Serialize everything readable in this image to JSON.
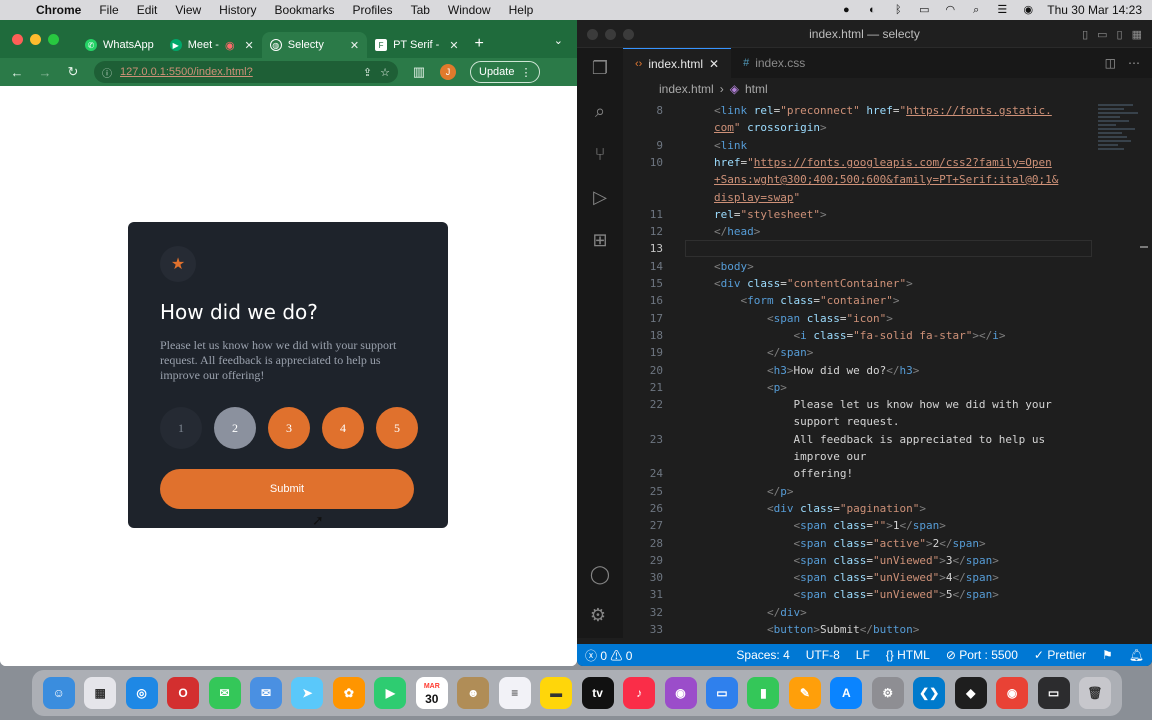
{
  "menubar": {
    "app": "Chrome",
    "items": [
      "File",
      "Edit",
      "View",
      "History",
      "Bookmarks",
      "Profiles",
      "Tab",
      "Window",
      "Help"
    ],
    "clock": "Thu 30 Mar  14:23"
  },
  "chrome": {
    "tabs": [
      {
        "label": "WhatsApp",
        "favicon_color": "#25d366"
      },
      {
        "label": "Meet -",
        "favicon_color": "#00a86b"
      },
      {
        "label": "Selecty",
        "favicon_color": "#ffffff"
      },
      {
        "label": "PT Serif - ",
        "favicon_color": "#ffffff"
      }
    ],
    "url": "127.0.0.1:5500/index.html?",
    "profile_initial": "J",
    "update_label": "Update"
  },
  "card": {
    "title": "How did we do?",
    "description": "Please let us know how we did with your support request. All feedback is appreciated to help us improve our offering!",
    "ratings": [
      {
        "label": "1",
        "state": "plain"
      },
      {
        "label": "2",
        "state": "active"
      },
      {
        "label": "3",
        "state": "unviewed"
      },
      {
        "label": "4",
        "state": "unviewed"
      },
      {
        "label": "5",
        "state": "unviewed"
      }
    ],
    "submit_label": "Submit",
    "accent": "#e0712d"
  },
  "vscode": {
    "window_title": "index.html — selecty",
    "tabs": [
      "index.html",
      "index.css"
    ],
    "breadcrumb": [
      "index.html",
      "html"
    ],
    "lines": [
      {
        "n": "8",
        "html": "<span class=\"tag\">&lt;</span><span class=\"tn\">link</span> <span class=\"at\">rel</span>=<span class=\"st\">\"preconnect\"</span> <span class=\"at\">href</span>=<span class=\"st\">\"</span><span class=\"url\">https://fonts.gstatic.</span>"
      },
      {
        "n": "",
        "html": "<span class=\"url\">com</span><span class=\"st\">\"</span> <span class=\"at\">crossorigin</span><span class=\"tag\">&gt;</span>"
      },
      {
        "n": "9",
        "html": "<span class=\"tag\">&lt;</span><span class=\"tn\">link</span>"
      },
      {
        "n": "10",
        "html": "<span class=\"at\">href</span>=<span class=\"st\">\"</span><span class=\"url\">https://fonts.googleapis.com/css2?family=Open</span>"
      },
      {
        "n": "",
        "html": "<span class=\"url\">+Sans:wght@300;400;500;600&amp;family=PT+Serif:ital@0;1&amp;</span>"
      },
      {
        "n": "",
        "html": "<span class=\"url\">display=swap</span><span class=\"st\">\"</span>"
      },
      {
        "n": "11",
        "html": "<span class=\"at\">rel</span>=<span class=\"st\">\"stylesheet\"</span><span class=\"tag\">&gt;</span>"
      },
      {
        "n": "12",
        "html": "<span class=\"tag\">&lt;/</span><span class=\"tn\">head</span><span class=\"tag\">&gt;</span>"
      },
      {
        "n": "13",
        "html": ""
      },
      {
        "n": "14",
        "html": "<span class=\"tag\">&lt;</span><span class=\"tn\">body</span><span class=\"tag\">&gt;</span>"
      },
      {
        "n": "15",
        "html": "<span class=\"tag\">&lt;</span><span class=\"tn\">div</span> <span class=\"at\">class</span>=<span class=\"st\">\"contentContainer\"</span><span class=\"tag\">&gt;</span>"
      },
      {
        "n": "16",
        "html": "    <span class=\"tag\">&lt;</span><span class=\"tn\">form</span> <span class=\"at\">class</span>=<span class=\"st\">\"container\"</span><span class=\"tag\">&gt;</span>"
      },
      {
        "n": "17",
        "html": "        <span class=\"tag\">&lt;</span><span class=\"tn\">span</span> <span class=\"at\">class</span>=<span class=\"st\">\"icon\"</span><span class=\"tag\">&gt;</span>"
      },
      {
        "n": "18",
        "html": "            <span class=\"tag\">&lt;</span><span class=\"tn\">i</span> <span class=\"at\">class</span>=<span class=\"st\">\"fa-solid fa-star\"</span><span class=\"tag\">&gt;&lt;/</span><span class=\"tn\">i</span><span class=\"tag\">&gt;</span>"
      },
      {
        "n": "19",
        "html": "        <span class=\"tag\">&lt;/</span><span class=\"tn\">span</span><span class=\"tag\">&gt;</span>"
      },
      {
        "n": "20",
        "html": "        <span class=\"tag\">&lt;</span><span class=\"tn\">h3</span><span class=\"tag\">&gt;</span><span class=\"tx\">How did we do?</span><span class=\"tag\">&lt;/</span><span class=\"tn\">h3</span><span class=\"tag\">&gt;</span>"
      },
      {
        "n": "21",
        "html": "        <span class=\"tag\">&lt;</span><span class=\"tn\">p</span><span class=\"tag\">&gt;</span>"
      },
      {
        "n": "22",
        "html": "            <span class=\"tx\">Please let us know how we did with your</span>"
      },
      {
        "n": "",
        "html": "            <span class=\"tx\">support request.</span>"
      },
      {
        "n": "23",
        "html": "            <span class=\"tx\">All feedback is appreciated to help us</span>"
      },
      {
        "n": "",
        "html": "            <span class=\"tx\">improve our</span>"
      },
      {
        "n": "24",
        "html": "            <span class=\"tx\">offering!</span>"
      },
      {
        "n": "25",
        "html": "        <span class=\"tag\">&lt;/</span><span class=\"tn\">p</span><span class=\"tag\">&gt;</span>"
      },
      {
        "n": "26",
        "html": "        <span class=\"tag\">&lt;</span><span class=\"tn\">div</span> <span class=\"at\">class</span>=<span class=\"st\">\"pagination\"</span><span class=\"tag\">&gt;</span>"
      },
      {
        "n": "27",
        "html": "            <span class=\"tag\">&lt;</span><span class=\"tn\">span</span> <span class=\"at\">class</span>=<span class=\"st\">\"\"</span><span class=\"tag\">&gt;</span><span class=\"tx\">1</span><span class=\"tag\">&lt;/</span><span class=\"tn\">span</span><span class=\"tag\">&gt;</span>"
      },
      {
        "n": "28",
        "html": "            <span class=\"tag\">&lt;</span><span class=\"tn\">span</span> <span class=\"at\">class</span>=<span class=\"st\">\"active\"</span><span class=\"tag\">&gt;</span><span class=\"tx\">2</span><span class=\"tag\">&lt;/</span><span class=\"tn\">span</span><span class=\"tag\">&gt;</span>"
      },
      {
        "n": "29",
        "html": "            <span class=\"tag\">&lt;</span><span class=\"tn\">span</span> <span class=\"at\">class</span>=<span class=\"st\">\"unViewed\"</span><span class=\"tag\">&gt;</span><span class=\"tx\">3</span><span class=\"tag\">&lt;/</span><span class=\"tn\">span</span><span class=\"tag\">&gt;</span>"
      },
      {
        "n": "30",
        "html": "            <span class=\"tag\">&lt;</span><span class=\"tn\">span</span> <span class=\"at\">class</span>=<span class=\"st\">\"unViewed\"</span><span class=\"tag\">&gt;</span><span class=\"tx\">4</span><span class=\"tag\">&lt;/</span><span class=\"tn\">span</span><span class=\"tag\">&gt;</span>"
      },
      {
        "n": "31",
        "html": "            <span class=\"tag\">&lt;</span><span class=\"tn\">span</span> <span class=\"at\">class</span>=<span class=\"st\">\"unViewed\"</span><span class=\"tag\">&gt;</span><span class=\"tx\">5</span><span class=\"tag\">&lt;/</span><span class=\"tn\">span</span><span class=\"tag\">&gt;</span>"
      },
      {
        "n": "32",
        "html": "        <span class=\"tag\">&lt;/</span><span class=\"tn\">div</span><span class=\"tag\">&gt;</span>"
      },
      {
        "n": "33",
        "html": "        <span class=\"tag\">&lt;</span><span class=\"tn\">button</span><span class=\"tag\">&gt;</span><span class=\"tx\">Submit</span><span class=\"tag\">&lt;/</span><span class=\"tn\">button</span><span class=\"tag\">&gt;</span>"
      }
    ],
    "current_line": "13",
    "status": {
      "problems": "0",
      "warnings": "0",
      "spaces": "Spaces: 4",
      "encoding": "UTF-8",
      "eol": "LF",
      "language": "HTML",
      "port": "Port : 5500",
      "formatter": "Prettier"
    }
  },
  "dock": {
    "calendar_day": "30",
    "calendar_month": "MAR",
    "apps": [
      {
        "name": "finder-icon",
        "color": "#3a8dde",
        "glyph": "☺"
      },
      {
        "name": "launchpad-icon",
        "color": "#e5e5ea",
        "glyph": "▦"
      },
      {
        "name": "safari-icon",
        "color": "#1e88e5",
        "glyph": "◎"
      },
      {
        "name": "opera-icon",
        "color": "#d32f2f",
        "glyph": "O"
      },
      {
        "name": "messages-icon",
        "color": "#34c759",
        "glyph": "✉"
      },
      {
        "name": "mail-icon",
        "color": "#4a90e2",
        "glyph": "✉"
      },
      {
        "name": "maps-icon",
        "color": "#5ac8fa",
        "glyph": "➤"
      },
      {
        "name": "photos-icon",
        "color": "#ff9500",
        "glyph": "✿"
      },
      {
        "name": "facetime-icon",
        "color": "#2ecc71",
        "glyph": "▶"
      },
      {
        "name": "calendar-icon",
        "color": "#ffffff",
        "glyph": "30"
      },
      {
        "name": "contacts-icon",
        "color": "#b08d57",
        "glyph": "☻"
      },
      {
        "name": "reminders-icon",
        "color": "#f2f2f7",
        "glyph": "≡"
      },
      {
        "name": "notes-icon",
        "color": "#ffd60a",
        "glyph": "▬"
      },
      {
        "name": "appletv-icon",
        "color": "#111111",
        "glyph": "tv"
      },
      {
        "name": "music-icon",
        "color": "#fa2d48",
        "glyph": "♪"
      },
      {
        "name": "podcasts-icon",
        "color": "#9b4dca",
        "glyph": "◉"
      },
      {
        "name": "keynote-icon",
        "color": "#2f80ed",
        "glyph": "▭"
      },
      {
        "name": "numbers-icon",
        "color": "#34c759",
        "glyph": "▮"
      },
      {
        "name": "pages-icon",
        "color": "#ff9f0a",
        "glyph": "✎"
      },
      {
        "name": "appstore-icon",
        "color": "#0a84ff",
        "glyph": "A"
      },
      {
        "name": "settings-icon",
        "color": "#8e8e93",
        "glyph": "⚙"
      },
      {
        "name": "vscode-icon",
        "color": "#007acc",
        "glyph": "❮❯"
      },
      {
        "name": "figma-icon",
        "color": "#1e1e1e",
        "glyph": "◆"
      },
      {
        "name": "chrome-icon",
        "color": "#e94235",
        "glyph": "◉"
      },
      {
        "name": "window-switcher-icon",
        "color": "#2c2c2e",
        "glyph": "▭"
      },
      {
        "name": "trash-icon",
        "color": "#c7c7cc",
        "glyph": "🗑"
      }
    ]
  }
}
